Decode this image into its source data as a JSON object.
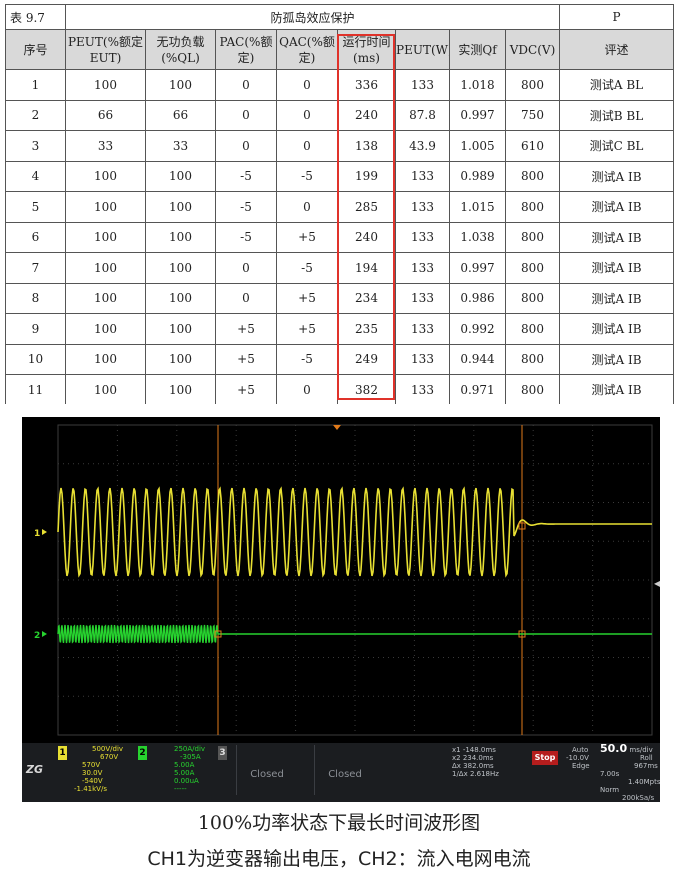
{
  "table": {
    "caption_left": "表 9.7",
    "caption_center": "防孤岛效应保护",
    "caption_right": "P",
    "headers": [
      "序号",
      "PEUT(%额定EUT)",
      "无功负载(%QL)",
      "PAC(%额定)",
      "QAC(%额定)",
      "运行时间(ms)",
      "PEUT(W)",
      "实测Qf",
      "VDC(V)",
      "评述"
    ],
    "rows": [
      [
        "1",
        "100",
        "100",
        "0",
        "0",
        "336",
        "133",
        "1.018",
        "800",
        "测试A BL"
      ],
      [
        "2",
        "66",
        "66",
        "0",
        "0",
        "240",
        "87.8",
        "0.997",
        "750",
        "测试B BL"
      ],
      [
        "3",
        "33",
        "33",
        "0",
        "0",
        "138",
        "43.9",
        "1.005",
        "610",
        "测试C BL"
      ],
      [
        "4",
        "100",
        "100",
        "-5",
        "-5",
        "199",
        "133",
        "0.989",
        "800",
        "测试A IB"
      ],
      [
        "5",
        "100",
        "100",
        "-5",
        "0",
        "285",
        "133",
        "1.015",
        "800",
        "测试A IB"
      ],
      [
        "6",
        "100",
        "100",
        "-5",
        "+5",
        "240",
        "133",
        "1.038",
        "800",
        "测试A IB"
      ],
      [
        "7",
        "100",
        "100",
        "0",
        "-5",
        "194",
        "133",
        "0.997",
        "800",
        "测试A IB"
      ],
      [
        "8",
        "100",
        "100",
        "0",
        "+5",
        "234",
        "133",
        "0.986",
        "800",
        "测试A IB"
      ],
      [
        "9",
        "100",
        "100",
        "+5",
        "+5",
        "235",
        "133",
        "0.992",
        "800",
        "测试A IB"
      ],
      [
        "10",
        "100",
        "100",
        "+5",
        "-5",
        "249",
        "133",
        "0.944",
        "800",
        "测试A IB"
      ],
      [
        "11",
        "100",
        "100",
        "+5",
        "0",
        "382",
        "133",
        "0.971",
        "800",
        "测试A IB"
      ]
    ],
    "highlight_color": "#e0322a"
  },
  "scope": {
    "ch1_marker": "1",
    "ch2_marker": "2",
    "ch1_color": "#e8e033",
    "ch2_color": "#27d32f",
    "cursor_color": "#e07a1a",
    "ch1_tag": "1",
    "ch1_lines": [
      "500V/div",
      "670V",
      "570V",
      "30.0V",
      "-540V",
      "-1.41kV/s"
    ],
    "ch2_tag": "2",
    "ch2_lines": [
      "250A/div",
      "-305A",
      "5.00A",
      "5.00A",
      "0.00uA",
      "-----"
    ],
    "ch3_tag": "3",
    "closed1": "Closed",
    "closed2": "Closed",
    "meas_lines": [
      "x1   -148.0ms",
      "x2   234.0ms",
      "Δx   382.0ms",
      "1/Δx  2.618Hz"
    ],
    "stop_label": "Stop",
    "trig_lines": [
      "Auto",
      "-10.0V",
      "Edge"
    ],
    "tb_main": "50.0",
    "tb_unit": "ms/div",
    "tb_lines": [
      "Roll",
      "967ms",
      "7.00s",
      "1.40Mpts",
      "Norm",
      "200kSa/s"
    ],
    "logo": "ZG"
  },
  "captions": {
    "line1": "100%功率状态下最长时间波形图",
    "line2": "CH1为逆变器输出电压，CH2：流入电网电流"
  }
}
